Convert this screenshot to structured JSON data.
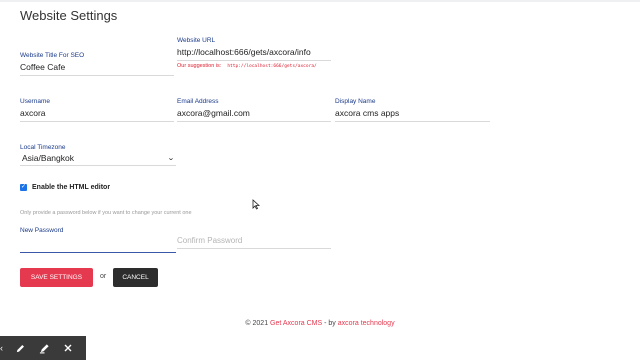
{
  "page": {
    "title": "Website Settings"
  },
  "site": {
    "title_label": "Website Title For SEO",
    "title_value": "Coffee Cafe",
    "url_label": "Website URL",
    "url_value": "http://localhost:666/gets/axcora/info",
    "suggestion_label": "Our suggestion is:",
    "suggestion_value": "http://localhost:666/gets/axcora/"
  },
  "account": {
    "username_label": "Username",
    "username_value": "axcora",
    "email_label": "Email Address",
    "email_value": "axcora@gmail.com",
    "display_label": "Display Name",
    "display_value": "axcora cms apps"
  },
  "timezone": {
    "label": "Local Timezone",
    "value": "Asia/Bangkok"
  },
  "html_editor": {
    "label": "Enable the HTML editor",
    "checked": true
  },
  "password": {
    "hint": "Only provide a password below if you want to change your current one",
    "new_label": "New Password",
    "confirm_placeholder": "Confirm Password"
  },
  "actions": {
    "save": "SAVE SETTINGS",
    "or": "or",
    "cancel": "CANCEL"
  },
  "footer": {
    "prefix": "© 2021",
    "brand": "Get Axcora CMS",
    "middle": "- by",
    "author": "axcora technology"
  },
  "colors": {
    "accent": "#e53950",
    "label": "#1a3a8a",
    "checkbox": "#1a73e8",
    "cancel": "#2d2d2d"
  },
  "icons": [
    "pencil-icon",
    "highlighter-icon",
    "close-icon",
    "cursor-icon"
  ]
}
